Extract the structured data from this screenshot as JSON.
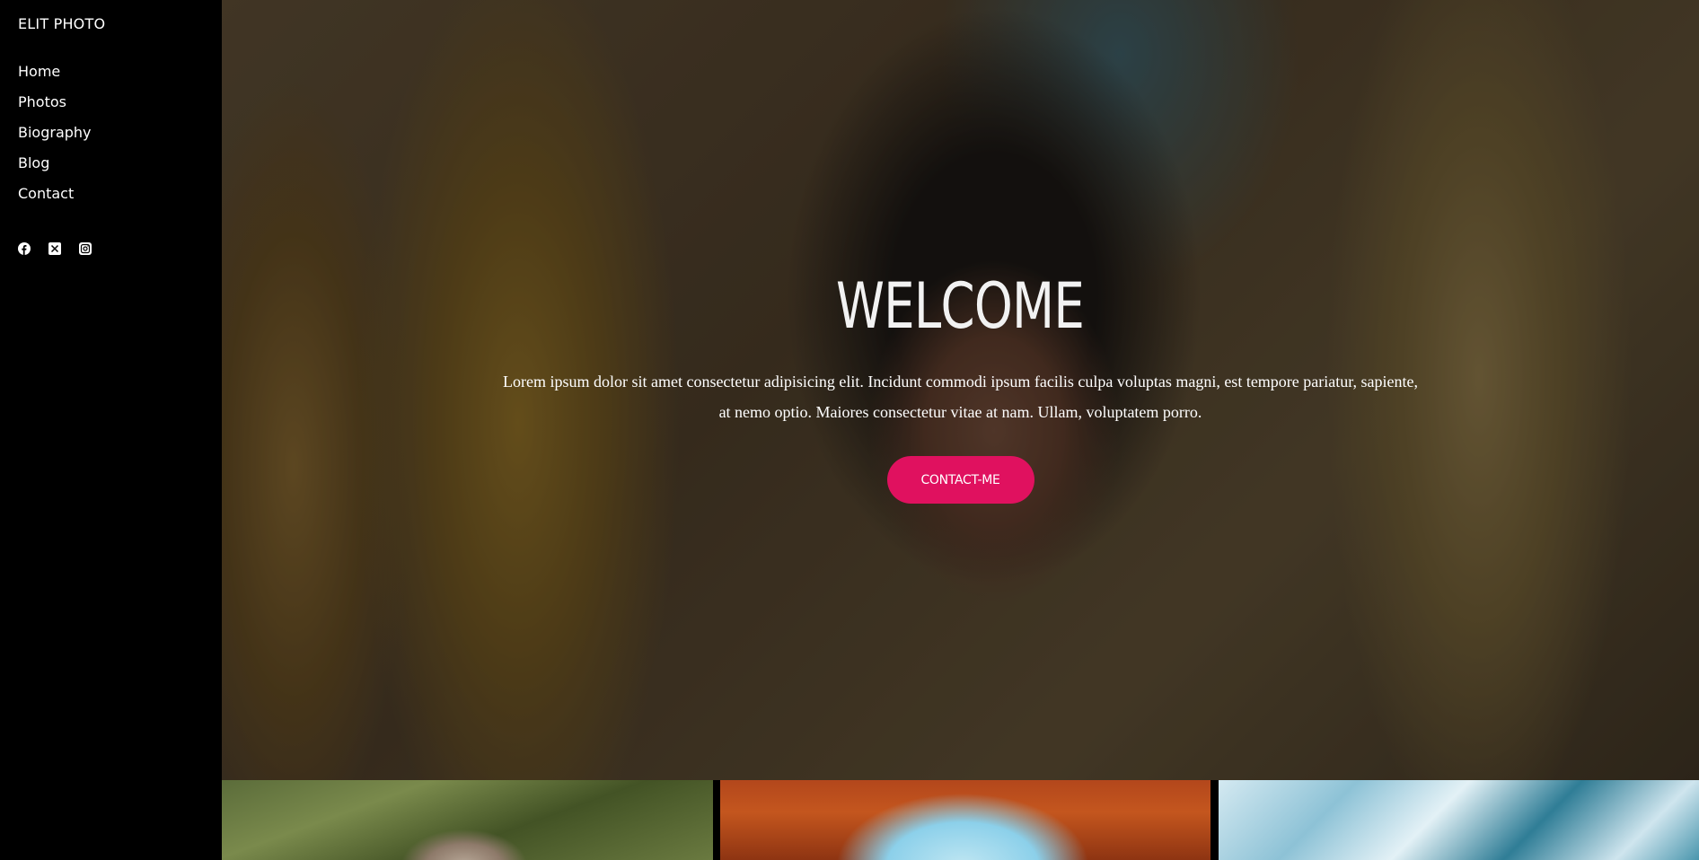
{
  "sidebar": {
    "brand": "ELIT PHOTO",
    "nav": [
      {
        "label": "Home"
      },
      {
        "label": "Photos"
      },
      {
        "label": "Biography"
      },
      {
        "label": "Blog"
      },
      {
        "label": "Contact"
      }
    ],
    "socials": [
      "facebook-icon",
      "x-twitter-icon",
      "instagram-icon"
    ]
  },
  "hero": {
    "title": "WELCOME",
    "text": "Lorem ipsum dolor sit amet consectetur adipisicing elit. Incidunt commodi ipsum facilis culpa voluptas magni, est tempore pariatur, sapiente, at nemo optio. Maiores consectetur vitae at nam. Ullam, voluptatem porro.",
    "button_label": "CONTACT-ME"
  },
  "colors": {
    "accent": "#e0115f",
    "sidebar_bg": "#000000",
    "text": "#ffffff"
  }
}
